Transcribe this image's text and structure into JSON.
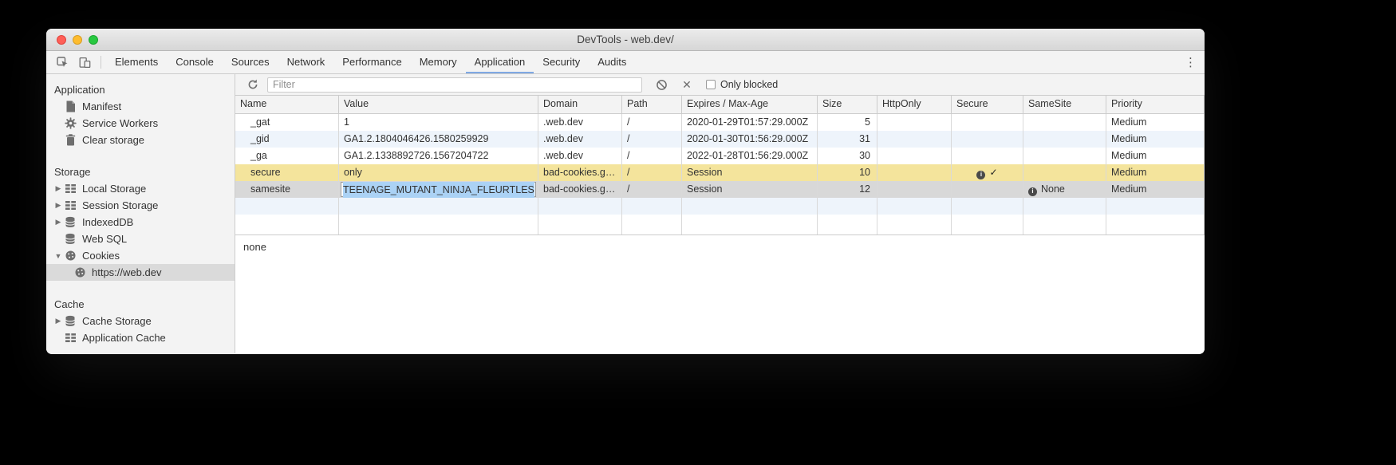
{
  "window": {
    "title": "DevTools - web.dev/"
  },
  "tabs": {
    "items": [
      {
        "label": "Elements",
        "selected": false
      },
      {
        "label": "Console",
        "selected": false
      },
      {
        "label": "Sources",
        "selected": false
      },
      {
        "label": "Network",
        "selected": false
      },
      {
        "label": "Performance",
        "selected": false
      },
      {
        "label": "Memory",
        "selected": false
      },
      {
        "label": "Application",
        "selected": true
      },
      {
        "label": "Security",
        "selected": false
      },
      {
        "label": "Audits",
        "selected": false
      }
    ],
    "more_icon_glyph": "⋮"
  },
  "sidebar": {
    "collapsed_glyph": "▶",
    "expanded_glyph": "▼",
    "sections": [
      {
        "title": "Application",
        "items": [
          {
            "label": "Manifest",
            "icon": "file-icon"
          },
          {
            "label": "Service Workers",
            "icon": "gear-icon"
          },
          {
            "label": "Clear storage",
            "icon": "trash-icon"
          }
        ]
      },
      {
        "title": "Storage",
        "items": [
          {
            "label": "Local Storage",
            "icon": "grid-icon",
            "arrow": "collapsed"
          },
          {
            "label": "Session Storage",
            "icon": "grid-icon",
            "arrow": "collapsed"
          },
          {
            "label": "IndexedDB",
            "icon": "database-icon",
            "arrow": "collapsed"
          },
          {
            "label": "Web SQL",
            "icon": "database-icon"
          },
          {
            "label": "Cookies",
            "icon": "cookie-icon",
            "arrow": "expanded"
          },
          {
            "label": "https://web.dev",
            "icon": "cookie-icon",
            "depth": 1,
            "selected": true
          }
        ]
      },
      {
        "title": "Cache",
        "items": [
          {
            "label": "Cache Storage",
            "icon": "database-icon",
            "arrow": "collapsed"
          },
          {
            "label": "Application Cache",
            "icon": "grid-icon"
          }
        ]
      }
    ]
  },
  "toolbar": {
    "filter_placeholder": "Filter",
    "only_blocked_label": "Only blocked",
    "clear_glyph": "✕"
  },
  "cookies_table": {
    "columns": [
      "Name",
      "Value",
      "Domain",
      "Path",
      "Expires / Max-Age",
      "Size",
      "HttpOnly",
      "Secure",
      "SameSite",
      "Priority"
    ],
    "rows": [
      {
        "name": "_gat",
        "value": "1",
        "domain": ".web.dev",
        "path": "/",
        "expires": "2020-01-29T01:57:29.000Z",
        "size": "5",
        "http_only": "",
        "secure": "",
        "same_site": "",
        "priority": "Medium",
        "highlight": "none"
      },
      {
        "name": "_gid",
        "value": "GA1.2.1804046426.1580259929",
        "domain": ".web.dev",
        "path": "/",
        "expires": "2020-01-30T01:56:29.000Z",
        "size": "31",
        "http_only": "",
        "secure": "",
        "same_site": "",
        "priority": "Medium",
        "highlight": "alt"
      },
      {
        "name": "_ga",
        "value": "GA1.2.1338892726.1567204722",
        "domain": ".web.dev",
        "path": "/",
        "expires": "2022-01-28T01:56:29.000Z",
        "size": "30",
        "http_only": "",
        "secure": "",
        "same_site": "",
        "priority": "Medium",
        "highlight": "none"
      },
      {
        "name": "secure",
        "value": "only",
        "domain": "bad-cookies.g…",
        "path": "/",
        "expires": "Session",
        "size": "10",
        "http_only": "",
        "secure": "✓",
        "secure_info": true,
        "same_site": "",
        "priority": "Medium",
        "highlight": "yellow"
      },
      {
        "name": "samesite",
        "value": "TEENAGE_MUTANT_NINJA_FLEURTLES",
        "value_editing": true,
        "domain": "bad-cookies.g…",
        "path": "/",
        "expires": "Session",
        "size": "12",
        "http_only": "",
        "secure": "",
        "same_site": "None",
        "same_site_info": true,
        "priority": "Medium",
        "highlight": "selected"
      }
    ]
  },
  "preview": {
    "text": "none"
  },
  "colors": {
    "accent_blue": "#7fa8e3",
    "row_alt": "#eef4fb",
    "row_yellow": "#f4e49c",
    "row_selected": "#d8d8d8",
    "selection_blue": "#abd2f5"
  }
}
